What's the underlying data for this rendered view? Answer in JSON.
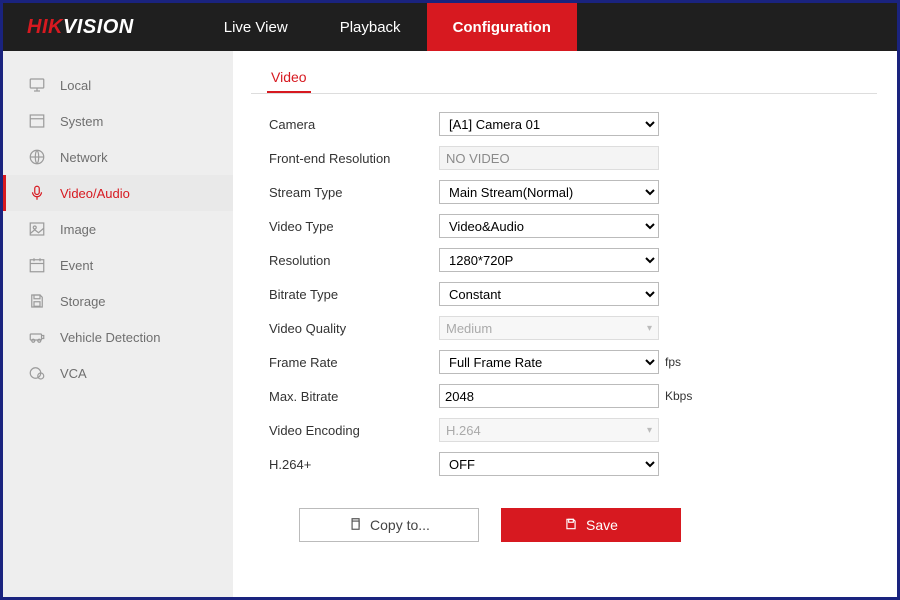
{
  "brand": {
    "part1": "HIK",
    "part2": "VISION"
  },
  "topnav": [
    {
      "label": "Live View",
      "active": false
    },
    {
      "label": "Playback",
      "active": false
    },
    {
      "label": "Configuration",
      "active": true
    }
  ],
  "sidebar": [
    {
      "label": "Local",
      "icon": "monitor-icon"
    },
    {
      "label": "System",
      "icon": "window-icon"
    },
    {
      "label": "Network",
      "icon": "globe-icon"
    },
    {
      "label": "Video/Audio",
      "icon": "mic-icon",
      "active": true
    },
    {
      "label": "Image",
      "icon": "image-icon"
    },
    {
      "label": "Event",
      "icon": "calendar-icon"
    },
    {
      "label": "Storage",
      "icon": "save-icon"
    },
    {
      "label": "Vehicle Detection",
      "icon": "vehicle-icon"
    },
    {
      "label": "VCA",
      "icon": "vca-icon"
    }
  ],
  "tabs": [
    {
      "label": "Video",
      "active": true
    }
  ],
  "form": {
    "camera": {
      "label": "Camera",
      "value": "[A1] Camera 01"
    },
    "frontend_res": {
      "label": "Front-end Resolution",
      "value": "NO VIDEO"
    },
    "stream_type": {
      "label": "Stream Type",
      "value": "Main Stream(Normal)"
    },
    "video_type": {
      "label": "Video Type",
      "value": "Video&Audio"
    },
    "resolution": {
      "label": "Resolution",
      "value": "1280*720P"
    },
    "bitrate_type": {
      "label": "Bitrate Type",
      "value": "Constant"
    },
    "video_quality": {
      "label": "Video Quality",
      "value": "Medium",
      "disabled": true
    },
    "frame_rate": {
      "label": "Frame Rate",
      "value": "Full Frame Rate",
      "unit": "fps"
    },
    "max_bitrate": {
      "label": "Max. Bitrate",
      "value": "2048",
      "unit": "Kbps"
    },
    "video_encoding": {
      "label": "Video Encoding",
      "value": "H.264",
      "disabled": true
    },
    "h264plus": {
      "label": "H.264+",
      "value": "OFF"
    }
  },
  "buttons": {
    "copy": "Copy to...",
    "save": "Save"
  },
  "colors": {
    "accent": "#d71920",
    "topbar": "#1f1f1f",
    "sidebar": "#eeeeee"
  }
}
